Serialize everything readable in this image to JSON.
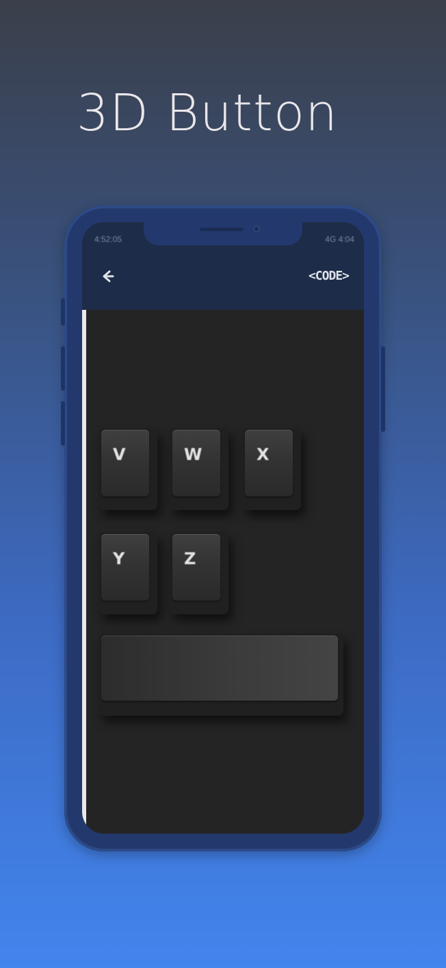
{
  "promo": {
    "title": "3D Button"
  },
  "status_bar": {
    "left": "4:52:05",
    "right": "4G 4:04"
  },
  "header": {
    "back_icon": "arrow-left-icon",
    "code_label": "<CODE>"
  },
  "keys": [
    {
      "letter": "V"
    },
    {
      "letter": "W"
    },
    {
      "letter": "X"
    },
    {
      "letter": "Y"
    },
    {
      "letter": "Z"
    }
  ],
  "colors": {
    "phone_frame": "#23396d",
    "app_header": "#1d2c48",
    "screen_bg": "#242424",
    "key_face": "#333333"
  }
}
